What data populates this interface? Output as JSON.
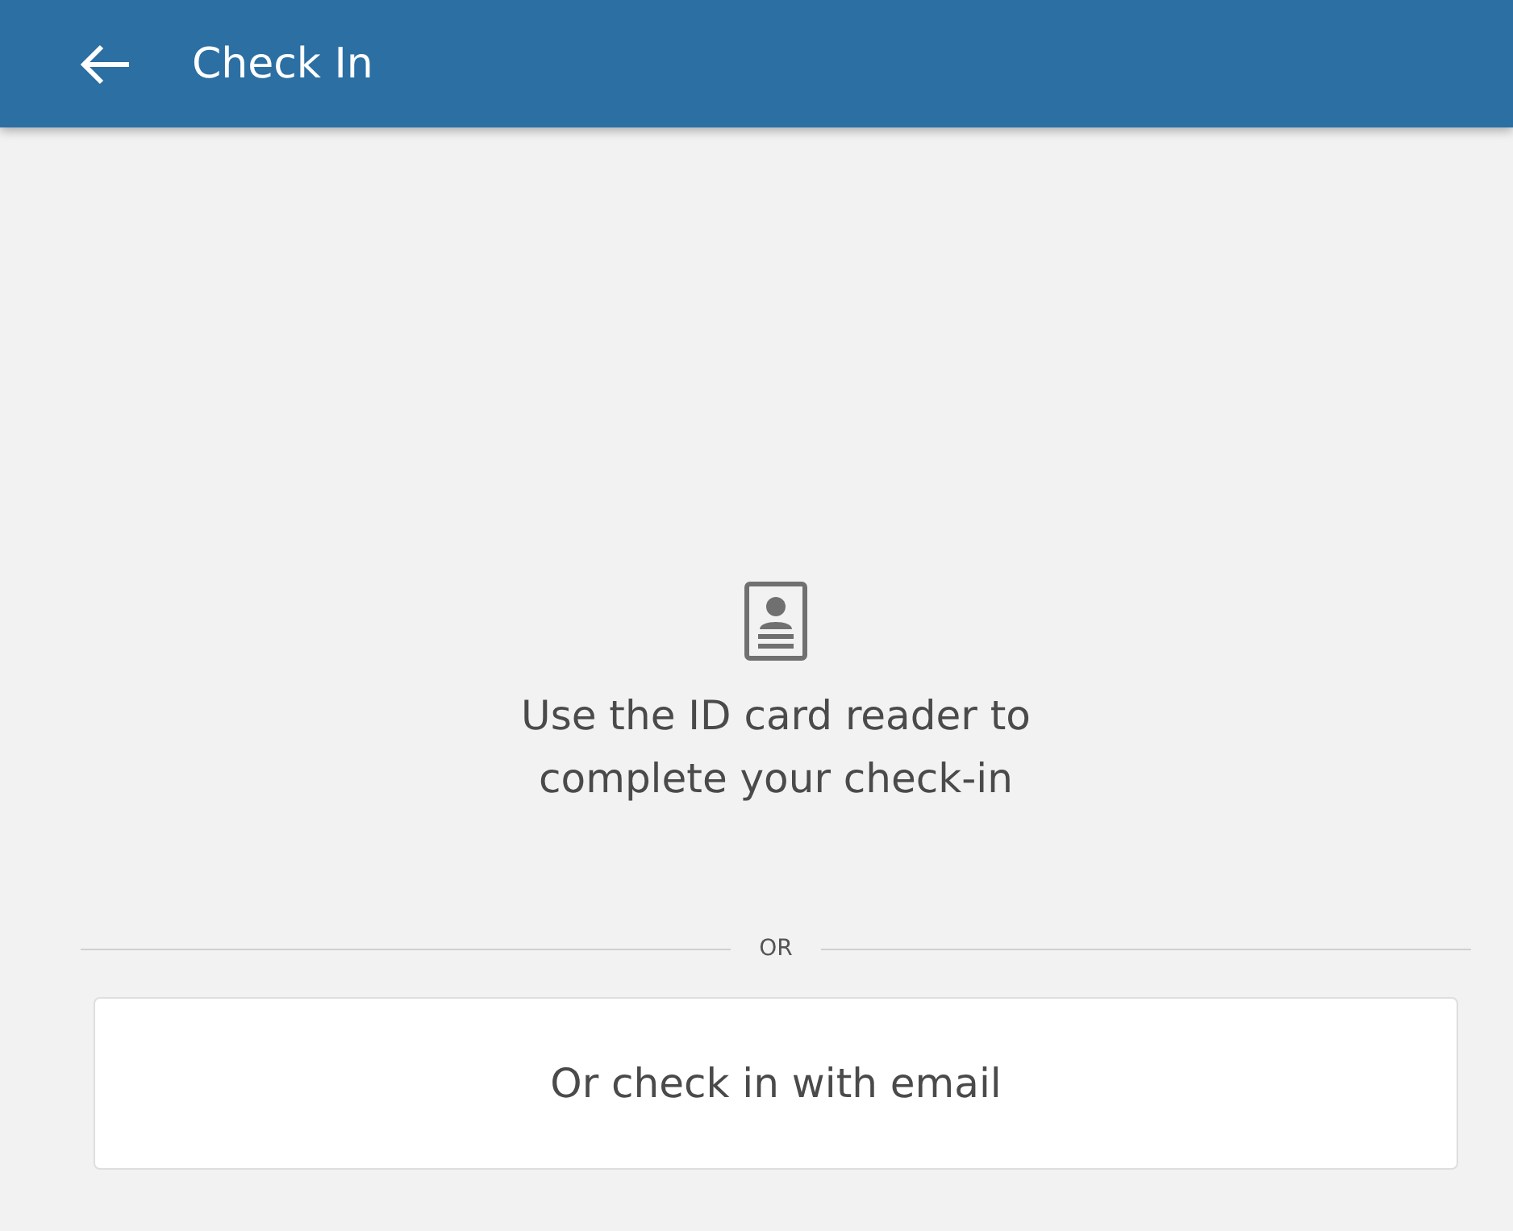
{
  "header": {
    "title": "Check In"
  },
  "instruction": "Use the ID card reader to complete your check-in",
  "divider": {
    "label": "OR"
  },
  "email_button": {
    "label": "Or check in with email"
  }
}
